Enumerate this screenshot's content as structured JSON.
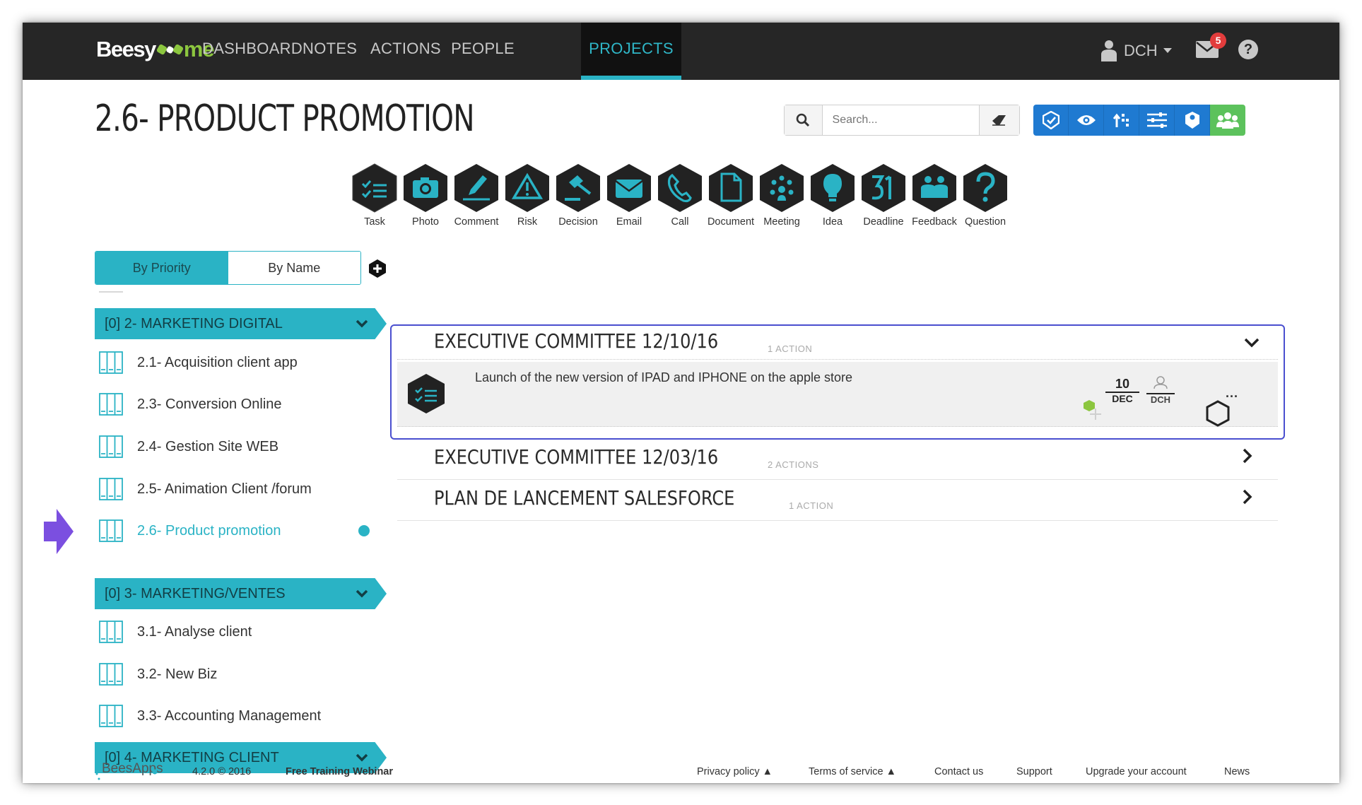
{
  "nav": {
    "logo_left": "Beesy",
    "logo_right": "me",
    "items": [
      "DASHBOARD",
      "NOTES",
      "ACTIONS",
      "PEOPLE",
      "PROJECTS"
    ],
    "active": "PROJECTS",
    "user": "DCH",
    "mail_count": "5",
    "help": "?"
  },
  "page": {
    "title": "2.6- PRODUCT PROMOTION"
  },
  "search": {
    "placeholder": "Search..."
  },
  "types": [
    {
      "label": "Task",
      "icon": "task-icon"
    },
    {
      "label": "Photo",
      "icon": "camera-icon"
    },
    {
      "label": "Comment",
      "icon": "pen-icon"
    },
    {
      "label": "Risk",
      "icon": "warning-icon"
    },
    {
      "label": "Decision",
      "icon": "gavel-icon"
    },
    {
      "label": "Email",
      "icon": "envelope-icon"
    },
    {
      "label": "Call",
      "icon": "phone-icon"
    },
    {
      "label": "Document",
      "icon": "document-icon"
    },
    {
      "label": "Meeting",
      "icon": "meeting-icon"
    },
    {
      "label": "Idea",
      "icon": "bulb-icon"
    },
    {
      "label": "Deadline",
      "icon": "calendar-icon"
    },
    {
      "label": "Feedback",
      "icon": "feedback-icon"
    },
    {
      "label": "Question",
      "icon": "question-icon"
    }
  ],
  "sort": {
    "by_priority": "By Priority",
    "by_name": "By Name"
  },
  "sidebar": {
    "groups": [
      {
        "label": "[0] 2- MARKETING DIGITAL"
      },
      {
        "label": "[0] 3- MARKETING/VENTES"
      },
      {
        "label": "[0] 4- MARKETING CLIENT"
      }
    ],
    "items": [
      {
        "label": "2.1- Acquisition client app"
      },
      {
        "label": "2.3- Conversion Online"
      },
      {
        "label": "2.4- Gestion Site WEB"
      },
      {
        "label": "2.5- Animation Client /forum"
      },
      {
        "label": "2.6- Product promotion"
      },
      {
        "label": "3.1- Analyse client"
      },
      {
        "label": "3.2- New Biz"
      },
      {
        "label": "3.3- Accounting Management"
      }
    ]
  },
  "meetings": [
    {
      "title": "EXECUTIVE COMMITTEE 12/10/16",
      "count": "1 ACTION"
    },
    {
      "title": "EXECUTIVE COMMITTEE 12/03/16",
      "count": "2 ACTIONS"
    },
    {
      "title": "PLAN DE LANCEMENT SALESFORCE",
      "count": "1 ACTION"
    }
  ],
  "action": {
    "text": "Launch of the new version of IPAD and IPHONE on the apple store",
    "day": "10",
    "month": "DEC",
    "owner": "DCH",
    "more": "..."
  },
  "footer": {
    "logo": "BeesApps",
    "version": "4.2.0 © 2016",
    "webinar": "Free Training Webinar",
    "links": [
      "Privacy policy ▲",
      "Terms of service ▲",
      "Contact us",
      "Support",
      "Upgrade your account",
      "News"
    ]
  },
  "colors": {
    "teal": "#2ab3c5",
    "navbar": "#262626",
    "toolbar_blue": "#1f7ad1",
    "toolbar_green": "#5cc25c",
    "logo_green": "#8cc63f",
    "selected_border": "#4a4fcf",
    "arrow": "#7b4fe0"
  }
}
